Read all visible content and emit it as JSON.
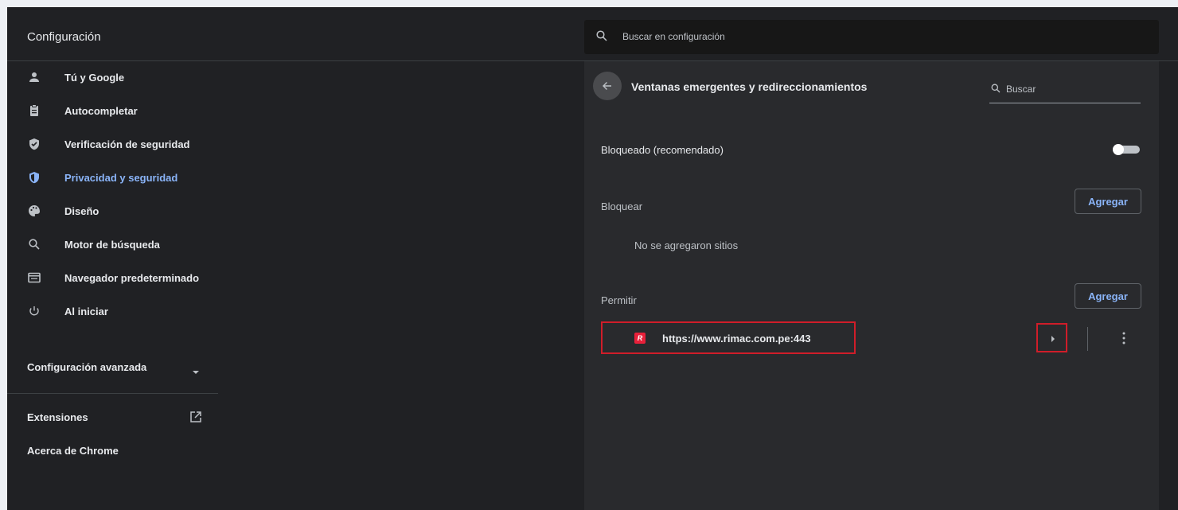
{
  "app": {
    "title": "Configuración"
  },
  "search": {
    "placeholder": "Buscar en configuración"
  },
  "sidebar": {
    "items": [
      {
        "label": "Tú y Google",
        "icon": "person-icon"
      },
      {
        "label": "Autocompletar",
        "icon": "clipboard-icon"
      },
      {
        "label": "Verificación de seguridad",
        "icon": "shield-check-icon"
      },
      {
        "label": "Privacidad y seguridad",
        "icon": "shield-icon",
        "active": true
      },
      {
        "label": "Diseño",
        "icon": "palette-icon"
      },
      {
        "label": "Motor de búsqueda",
        "icon": "search-icon"
      },
      {
        "label": "Navegador predeterminado",
        "icon": "browser-icon"
      },
      {
        "label": "Al iniciar",
        "icon": "power-icon"
      }
    ],
    "advanced_label": "Configuración avanzada",
    "extensions_label": "Extensiones",
    "about_label": "Acerca de Chrome"
  },
  "panel": {
    "title": "Ventanas emergentes y redireccionamientos",
    "search_placeholder": "Buscar",
    "blocked_label": "Bloqueado (recomendado)",
    "blocked_toggle_on": false,
    "block_section": "Bloquear",
    "add_label": "Agregar",
    "no_sites": "No se agregaron sitios",
    "allow_section": "Permitir",
    "allowed_sites": [
      {
        "url": "https://www.rimac.com.pe:443",
        "favicon_letter": "R"
      }
    ]
  },
  "colors": {
    "background": "#202124",
    "panel": "#292a2d",
    "accent": "#8ab4f8",
    "highlight": "#d01d29"
  }
}
